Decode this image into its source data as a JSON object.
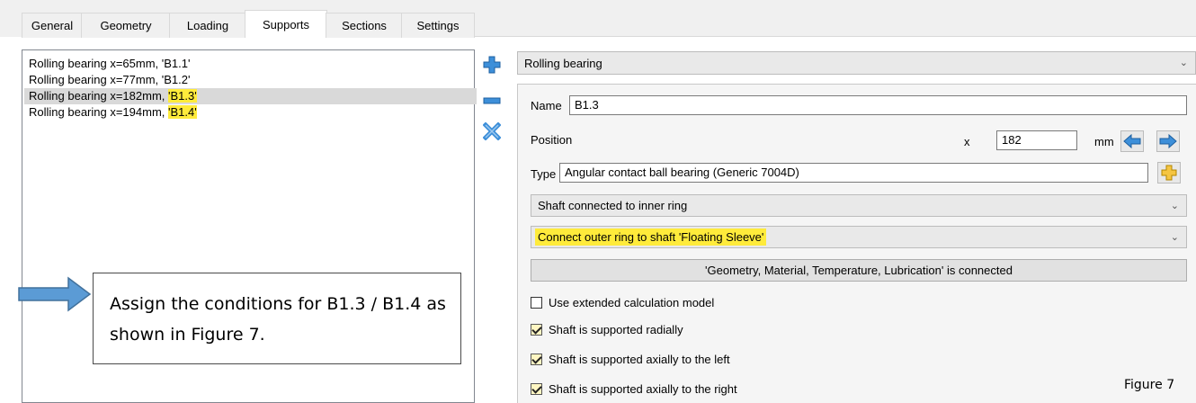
{
  "tabs": [
    {
      "label": "General",
      "active": false
    },
    {
      "label": "Geometry",
      "active": false
    },
    {
      "label": "Loading",
      "active": false
    },
    {
      "label": "Supports",
      "active": true
    },
    {
      "label": "Sections",
      "active": false
    },
    {
      "label": "Settings",
      "active": false
    }
  ],
  "supports_list": [
    {
      "prefix": "Rolling bearing  x=65mm, ",
      "name": "'B1.1'",
      "highlighted": false,
      "selected": false
    },
    {
      "prefix": "Rolling bearing  x=77mm, ",
      "name": "'B1.2'",
      "highlighted": false,
      "selected": false
    },
    {
      "prefix": "Rolling bearing  x=182mm, ",
      "name": "'B1.3'",
      "highlighted": true,
      "selected": true
    },
    {
      "prefix": "Rolling bearing  x=194mm, ",
      "name": "'B1.4'",
      "highlighted": true,
      "selected": false
    }
  ],
  "annotation": {
    "text": "Assign the conditions for B1.3 / B1.4 as shown in Figure 7."
  },
  "support_type": {
    "value": "Rolling bearing"
  },
  "form": {
    "name_label": "Name",
    "name_value": "B1.3",
    "position_label": "Position",
    "x_label": "x",
    "position_value": "182",
    "unit": "mm",
    "type_label": "Type",
    "type_value": "Angular contact ball bearing (Generic 7004D)",
    "inner_connection": "Shaft connected to inner ring",
    "outer_connection": "Connect outer ring to shaft 'Floating Sleeve'",
    "connected_info": "'Geometry, Material, Temperature, Lubrication' is connected",
    "checkboxes": [
      {
        "label": "Use extended calculation model",
        "checked": false
      },
      {
        "label": "Shaft is supported radially",
        "checked": true
      },
      {
        "label": "Shaft is supported axially to the left",
        "checked": true
      },
      {
        "label": "Shaft is supported axially to the right",
        "checked": true
      }
    ]
  },
  "figure_label": "Figure 7",
  "colors": {
    "highlight": "#ffeb3b",
    "icon_blue": "#3d8fd9",
    "accent_yellow": "#f5c542"
  }
}
